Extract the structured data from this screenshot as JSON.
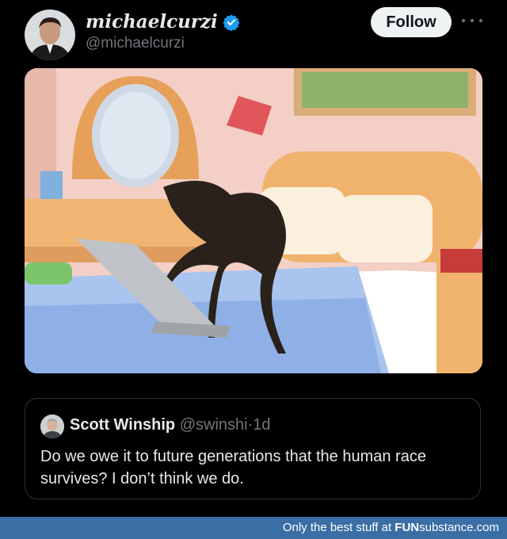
{
  "author": {
    "display_name": "michaelcurzi",
    "handle": "@michaelcurzi",
    "verified": true
  },
  "follow_label": "Follow",
  "media": {
    "icon": "image"
  },
  "quote": {
    "name": "Scott Winship",
    "handle": "@swinshi",
    "separator": "·",
    "time": "1d",
    "text": "Do we owe it to future generations that the human race survives? I don’t think we do."
  },
  "watermark": {
    "prefix": "Only the best stuff at ",
    "brand_bold": "FUN",
    "brand_rest": "substance.com"
  },
  "colors": {
    "background": "#000000",
    "verified": "#1d9bf0",
    "follow_bg": "#eff3f4",
    "muted": "#71767b",
    "footer": "#3a6ea5"
  }
}
